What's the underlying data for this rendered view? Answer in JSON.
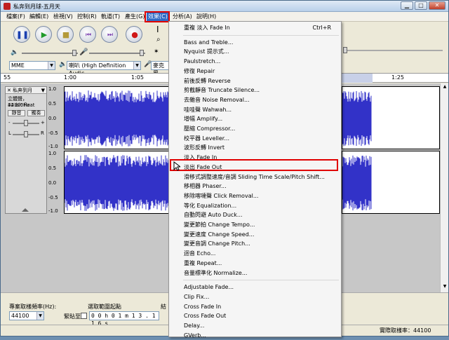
{
  "window": {
    "title": "私奔到月球-五月天"
  },
  "menubar": {
    "items": [
      {
        "label": "檔案(F)",
        "active": false
      },
      {
        "label": "編輯(E)",
        "active": false
      },
      {
        "label": "檢視(V)",
        "active": false
      },
      {
        "label": "控制(R)",
        "active": false
      },
      {
        "label": "軌道(T)",
        "active": false
      },
      {
        "label": "產生(G)",
        "active": false
      },
      {
        "label": "效果(C)",
        "active": true
      },
      {
        "label": "分析(A)",
        "active": false
      },
      {
        "label": "說明(H)",
        "active": false
      }
    ]
  },
  "toolbar": {
    "host_combo": "MME",
    "output_device_combo": "喇叭 (High Definition Audic",
    "input_device_combo": "麥克風"
  },
  "ruler": {
    "ticks": [
      "55",
      "1:00",
      "1:05",
      "1:25"
    ]
  },
  "track": {
    "name": "私奔到月",
    "info_line1": "立體聲，44100Hz",
    "info_line2": "32-bit float",
    "mute_label": "靜音",
    "solo_label": "獨奏",
    "minus_label": "-",
    "plus_label": "+",
    "left_label": "L",
    "right_label": "R",
    "scale_top": [
      "1.0",
      "0.5",
      "0.0",
      "-0.5",
      "-1.0"
    ],
    "scale_bottom": [
      "1.0",
      "0.5",
      "0.0",
      "-0.5",
      "-1.0"
    ]
  },
  "bottom": {
    "project_rate_label": "專案取樣頻率(Hz):",
    "project_rate_value": "44100",
    "snap_label": "緊貼至",
    "selection_label": "選取範圍起點",
    "selection_value": "0 0 h 0 1 m 1 3 . 1 1 6 s",
    "radio_label": "結"
  },
  "status": {
    "actual_rate": "實際取樣率：44100"
  },
  "effects_menu": {
    "groups": [
      [
        {
          "label": "重複 淡入 Fade In",
          "shortcut": "Ctrl+R"
        }
      ],
      [
        {
          "label": "Bass and Treble..."
        },
        {
          "label": "Nyquist 提示式..."
        },
        {
          "label": "Paulstretch..."
        },
        {
          "label": "修復 Repair"
        },
        {
          "label": "前後反轉 Reverse"
        },
        {
          "label": "剪截靜音 Truncate Silence..."
        },
        {
          "label": "去雜音 Noise Removal..."
        },
        {
          "label": "哇哇聲 Wahwah..."
        },
        {
          "label": "增幅 Amplify..."
        },
        {
          "label": "壓縮 Compressor..."
        },
        {
          "label": "校平器 Leveller..."
        },
        {
          "label": "波形反轉 Invert"
        },
        {
          "label": "淡入 Fade In"
        },
        {
          "label": "淡出 Fade Out",
          "highlighted": true
        },
        {
          "label": "滑移式調整速度/音調 Sliding Time Scale/Pitch Shift..."
        },
        {
          "label": "移相器 Phaser..."
        },
        {
          "label": "移除喀噠聲 Click Removal..."
        },
        {
          "label": "等化 Equalization..."
        },
        {
          "label": "自動閃避 Auto Duck..."
        },
        {
          "label": "變更節拍 Change Tempo..."
        },
        {
          "label": "變更速度 Change Speed..."
        },
        {
          "label": "變更音調 Change Pitch..."
        },
        {
          "label": "迴音 Echo..."
        },
        {
          "label": "重複 Repeat..."
        },
        {
          "label": "音量標準化 Normalize..."
        }
      ],
      [
        {
          "label": "Adjustable Fade..."
        },
        {
          "label": "Clip Fix..."
        },
        {
          "label": "Cross Fade In"
        },
        {
          "label": "Cross Fade Out"
        },
        {
          "label": "Delay..."
        },
        {
          "label": "GVerb..."
        }
      ]
    ]
  },
  "colors": {
    "highlight": "#e00000",
    "wave": "#3232c8",
    "selection": "#316ac5"
  }
}
